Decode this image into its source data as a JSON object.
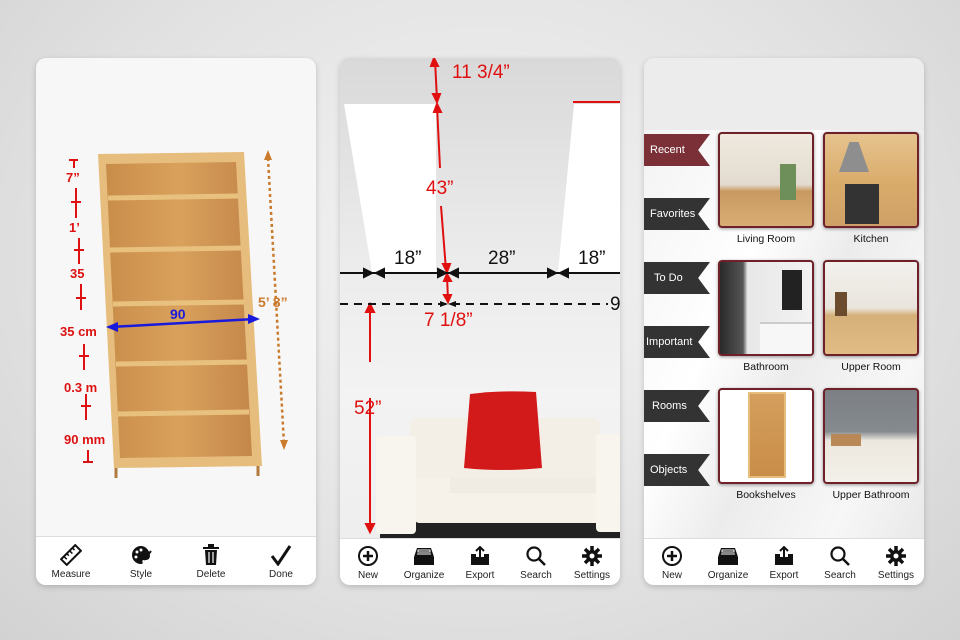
{
  "screen_measure": {
    "scale_labels": [
      "7”",
      "1’",
      "35",
      "35 cm",
      "0.3 m",
      "90 mm"
    ],
    "width_label": "90",
    "height_label": "5’ 8”",
    "colors": {
      "scale": "#dd1111",
      "width_arrow": "#1a1adc",
      "height_arrow": "#c97a2a"
    },
    "toolbar": [
      {
        "icon": "ruler-icon",
        "label": "Measure"
      },
      {
        "icon": "palette-icon",
        "label": "Style"
      },
      {
        "icon": "trash-icon",
        "label": "Delete"
      },
      {
        "icon": "checkmark-icon",
        "label": "Done"
      }
    ]
  },
  "screen_room": {
    "measurements": {
      "top_gap": "11 3/4”",
      "window_height": "43”",
      "left_wall": "18”",
      "between_windows": "28”",
      "right_wall": "18”",
      "window_to_line": "7 1/8”",
      "partial_label": "9",
      "floor_to_line": "52”"
    },
    "toolbar": [
      {
        "icon": "plus-circle-icon",
        "label": "New"
      },
      {
        "icon": "inbox-icon",
        "label": "Organize"
      },
      {
        "icon": "export-icon",
        "label": "Export"
      },
      {
        "icon": "search-icon",
        "label": "Search"
      },
      {
        "icon": "gear-icon",
        "label": "Settings"
      }
    ]
  },
  "screen_library": {
    "categories": [
      {
        "label": "Recent",
        "active": true
      },
      {
        "label": "Favorites",
        "active": false
      },
      {
        "label": "To Do",
        "active": false
      },
      {
        "label": "Important",
        "active": false
      },
      {
        "label": "Rooms",
        "active": false
      },
      {
        "label": "Objects",
        "active": false
      }
    ],
    "items": [
      {
        "label": "Living Room"
      },
      {
        "label": "Kitchen"
      },
      {
        "label": "Bathroom"
      },
      {
        "label": "Upper Room"
      },
      {
        "label": "Bookshelves"
      },
      {
        "label": "Upper Bathroom"
      }
    ],
    "colors": {
      "active_ribbon": "#7a3036",
      "ribbon": "#333333",
      "thumb_border": "#6e2128"
    },
    "toolbar": [
      {
        "icon": "plus-circle-icon",
        "label": "New"
      },
      {
        "icon": "inbox-icon",
        "label": "Organize"
      },
      {
        "icon": "export-icon",
        "label": "Export"
      },
      {
        "icon": "search-icon",
        "label": "Search"
      },
      {
        "icon": "gear-icon",
        "label": "Settings"
      }
    ]
  }
}
